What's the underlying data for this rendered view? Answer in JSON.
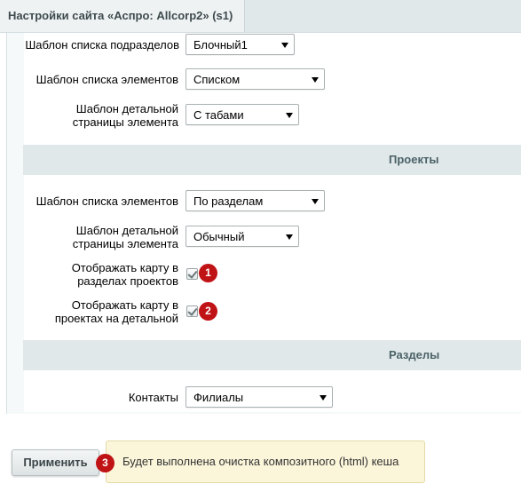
{
  "tab": {
    "title": "Настройки сайта «Аспро: Allcorp2» (s1)"
  },
  "rows": [
    {
      "label": "Шаблон списка подразделов",
      "value": "Блочный1"
    },
    {
      "label": "Шаблон списка элементов",
      "value": "Списком"
    },
    {
      "label_line1": "Шаблон детальной",
      "label_line2": "страницы элемента",
      "value": "С табами"
    }
  ],
  "projects": {
    "header": "Проекты",
    "list_label": "Шаблон списка элементов",
    "list_value": "По разделам",
    "detail_label_line1": "Шаблон детальной",
    "detail_label_line2": "страницы элемента",
    "detail_value": "Обычный",
    "map_sections_line1": "Отображать карту в",
    "map_sections_line2": "разделах проектов",
    "map_sections_checked": true,
    "map_detail_line1": "Отображать карту в",
    "map_detail_line2": "проектах на детальной",
    "map_detail_checked": true
  },
  "sections": {
    "header": "Разделы",
    "contacts_label": "Контакты",
    "contacts_value": "Филиалы"
  },
  "badges": [
    "1",
    "2",
    "3"
  ],
  "footer": {
    "apply_label": "Применить",
    "tooltip": "Будет выполнена очистка композитного (html) кеша"
  },
  "colors": {
    "badge": "#c01315",
    "section_bg": "#e0e8ea",
    "tooltip_bg": "#fbf6da"
  }
}
